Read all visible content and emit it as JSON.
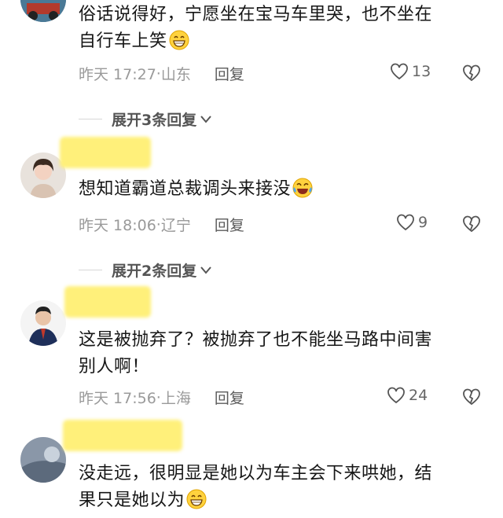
{
  "comments": [
    {
      "text_lines": [
        "俗话说得好，宁愿坐在宝马车里哭，也不坐在",
        "自行车上笑"
      ],
      "emoji": "grin-emoji",
      "time": "昨天 17:27",
      "location": "山东",
      "reply_label": "回复",
      "likes": "13"
    },
    {
      "text_lines": [
        "想知道霸道总裁调头来接没"
      ],
      "emoji": "laugh-tears-emoji",
      "time": "昨天 18:06",
      "location": "辽宁",
      "reply_label": "回复",
      "likes": "9"
    },
    {
      "text_lines": [
        "这是被抛弃了？被抛弃了也不能坐马路中间害",
        "别人啊！"
      ],
      "emoji": "",
      "time": "昨天 17:56",
      "location": "上海",
      "reply_label": "回复",
      "likes": "24"
    },
    {
      "text_lines": [
        "没走远，很明显是她以为车主会下来哄她，结",
        "果只是她以为"
      ],
      "emoji": "grin-emoji",
      "time": "",
      "location": "",
      "reply_label": "",
      "likes": ""
    }
  ],
  "expand": [
    {
      "label": "展开3条回复"
    },
    {
      "label": "展开2条回复"
    }
  ],
  "separator": "·",
  "colors": {
    "name_highlight": "#fff07a",
    "meta_text": "#9a9a9a",
    "body_text": "#161616"
  }
}
